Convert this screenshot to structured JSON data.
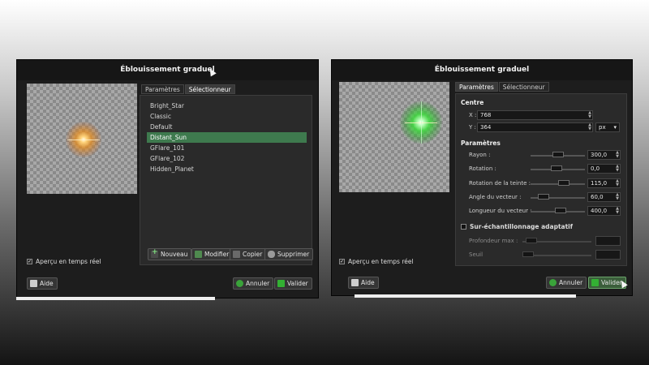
{
  "left_window": {
    "title": "Éblouissement graduel",
    "tabs": [
      "Paramètres",
      "Sélectionneur"
    ],
    "active_tab": "Sélectionneur",
    "flare_list": [
      "Bright_Star",
      "Classic",
      "Default",
      "Distant_Sun",
      "GFlare_101",
      "GFlare_102",
      "Hidden_Planet"
    ],
    "selected_flare": "Distant_Sun",
    "buttons": {
      "new": "Nouveau",
      "edit": "Modifier",
      "copy": "Copier",
      "delete": "Supprimer"
    },
    "realtime_preview": "Aperçu en temps réel",
    "realtime_checked": true,
    "help": "Aide",
    "cancel": "Annuler",
    "ok": "Valider",
    "flare_color": "#f0a030"
  },
  "right_window": {
    "title": "Éblouissement graduel",
    "tabs": [
      "Paramètres",
      "Sélectionneur"
    ],
    "active_tab": "Paramètres",
    "centre": {
      "heading": "Centre",
      "x_label": "X :",
      "x_value": "768",
      "y_label": "Y :",
      "y_value": "364",
      "unit": "px"
    },
    "parametres": {
      "heading": "Paramètres",
      "rows": [
        {
          "label": "Rayon :",
          "value": "300,0",
          "level": 0.5
        },
        {
          "label": "Rotation :",
          "value": "0,0",
          "level": 0.47
        },
        {
          "label": "Rotation de la teinte :",
          "value": "115,0",
          "level": 0.65
        },
        {
          "label": "Angle du vecteur :",
          "value": "60,0",
          "level": 0.17
        },
        {
          "label": "Longueur du vecteur :",
          "value": "400,0",
          "level": 0.57
        }
      ]
    },
    "supersampling": {
      "heading": "Sur-échantillonnage adaptatif",
      "checked": false,
      "depth_label": "Profondeur max :",
      "threshold_label": "Seuil"
    },
    "realtime_preview": "Aperçu en temps réel",
    "realtime_checked": true,
    "help": "Aide",
    "cancel": "Annuler",
    "ok": "Valider",
    "flare_color": "#40e040"
  }
}
